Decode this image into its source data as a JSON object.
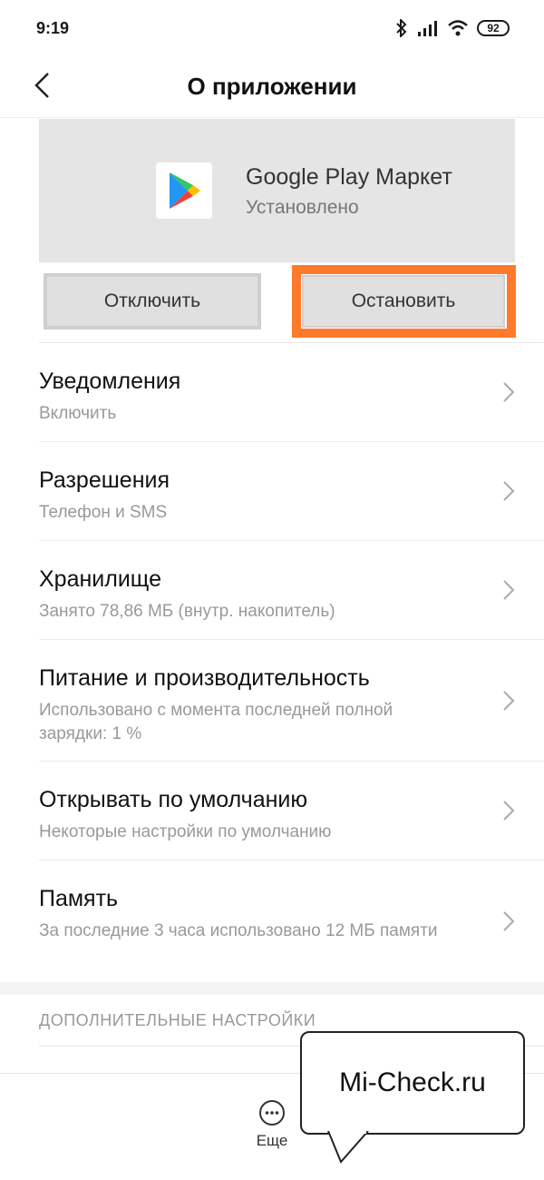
{
  "status_bar": {
    "time": "9:19",
    "battery": "92",
    "icons": [
      "bluetooth-icon",
      "signal-icon",
      "wifi-icon",
      "battery-icon"
    ]
  },
  "header": {
    "title": "О приложении"
  },
  "app": {
    "name": "Google Play Маркет",
    "status": "Установлено",
    "icon": "google-play-icon"
  },
  "buttons": {
    "disable": "Отключить",
    "stop": "Остановить"
  },
  "items": [
    {
      "title": "Уведомления",
      "sub": "Включить"
    },
    {
      "title": "Разрешения",
      "sub": "Телефон и SMS"
    },
    {
      "title": "Хранилище",
      "sub": "Занято 78,86 МБ (внутр. накопитель)"
    },
    {
      "title": "Питание и производительность",
      "sub": "Использовано с момента последней полной зарядки: 1 %"
    },
    {
      "title": "Открывать по умолчанию",
      "sub": "Некоторые настройки по умолчанию"
    },
    {
      "title": "Память",
      "sub": "За последние 3 часа использовано 12 МБ памяти"
    }
  ],
  "section": {
    "title": "ДОПОЛНИТЕЛЬНЫЕ НАСТРОЙКИ"
  },
  "bottom": {
    "more_label": "Еще"
  },
  "watermark": {
    "text": "Mi-Check.ru"
  },
  "colors": {
    "highlight": "#ff7a2b",
    "card_bg": "#e5e5e5"
  }
}
